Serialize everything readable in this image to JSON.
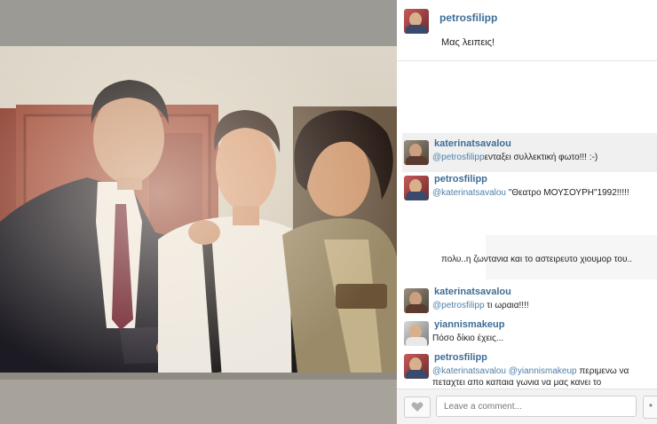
{
  "post": {
    "author": "petrosfilipp",
    "caption": "Μας λειπεις!"
  },
  "comments": [
    {
      "user": "katerinatsavalou",
      "mention": "@petrosfilipp",
      "text": "ενταξει συλλεκτική φωτο!!! :-)"
    },
    {
      "user": "petrosfilipp",
      "mention": "@katerinatsavalou",
      "text": " \"Θεατρο ΜΟΥΣΟΥΡΗ\"1992!!!!!"
    },
    {
      "user": "",
      "mention": "",
      "text": "πολυ..η ζωντανια και το αστειρευτο χιουμορ του.."
    },
    {
      "user": "katerinatsavalou",
      "mention": "@petrosfilipp",
      "text": " τι ωραια!!!!"
    },
    {
      "user": "yiannismakeup",
      "mention": "",
      "text": "Πόσο δίκιο έχεις..."
    },
    {
      "user": "petrosfilipp",
      "mention": "@katerinatsavalou @yiannismakeup",
      "text": " περιμενω να πεταχτει απο καπαια γωνια να μας κανει το"
    }
  ],
  "footer": {
    "comment_placeholder": "Leave a comment...",
    "more_label": "•"
  },
  "colors": {
    "username": "#3e6d96",
    "mention": "#4f7fa8",
    "panel_bg": "#ffffff",
    "footer_bg": "#f3f3f3"
  },
  "icons": [
    "heart-icon",
    "ellipsis-icon"
  ]
}
